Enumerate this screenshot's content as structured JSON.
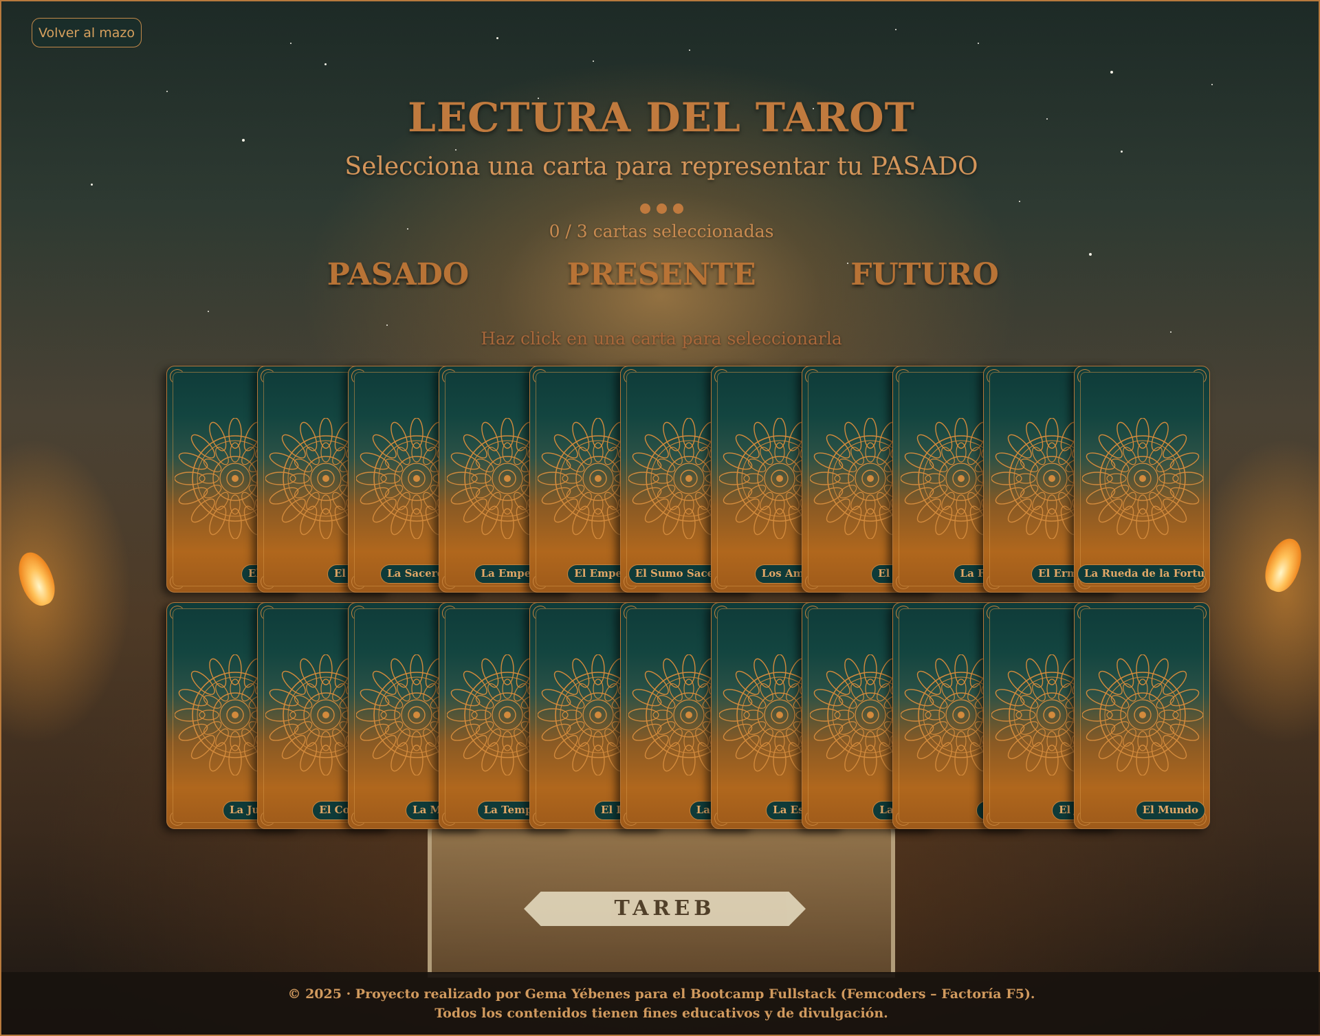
{
  "nav": {
    "back_label": "Volver al mazo"
  },
  "header": {
    "title": "LECTURA DEL TAROT",
    "subtitle": "Selecciona una carta para representar tu PASADO",
    "progress": {
      "selected": 0,
      "total": 3
    },
    "counter_text": "0 / 3 cartas seleccionadas"
  },
  "positions": [
    "PASADO",
    "PRESENTE",
    "FUTURO"
  ],
  "hint": "Haz click en una carta para seleccionarla",
  "deck": {
    "row1": [
      "El Loco",
      "El Mago",
      "La Sacerdotisa",
      "La Emperatriz",
      "El Emperador",
      "El Sumo Sacerdote",
      "Los Amantes",
      "El Carro",
      "La Fuerza",
      "El Ermitaño",
      "La Rueda de la Fortuna"
    ],
    "row2": [
      "La Justicia",
      "El Colgado",
      "La Muerte",
      "La Templanza",
      "El Diablo",
      "La Torre",
      "La Estrella",
      "La Luna",
      "El Sol",
      "El Juicio",
      "El Mundo"
    ]
  },
  "background_label": "TAREB",
  "footer": {
    "line1": "© 2025 · Proyecto realizado por Gema Yébenes para el Bootcamp Fullstack (Femcoders – Factoría F5).",
    "line2": "Todos los contenidos tienen fines educativos y de divulgación."
  },
  "colors": {
    "accent": "#c07a3e",
    "card_teal": "#0f3b39",
    "card_amber": "#b0671d"
  }
}
